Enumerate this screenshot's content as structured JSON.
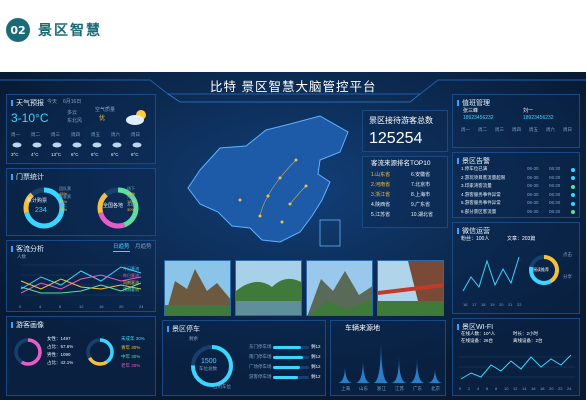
{
  "section": {
    "number": "02",
    "title": "景区智慧"
  },
  "header": {
    "title": "比特 景区智慧大脑管控平台"
  },
  "weather": {
    "title": "天气预报",
    "today_label": "今天",
    "date": "6月16日",
    "temp": "3-10°C",
    "wind_label": "多云",
    "wind_value": "东北风",
    "aqi_label": "空气质量",
    "aqi_value": "优",
    "days": [
      "周一",
      "周二",
      "周三",
      "周四",
      "周五",
      "周六",
      "周日"
    ],
    "temps": [
      "3°C",
      "4°C",
      "13°C",
      "6°C",
      "6°C",
      "6°C",
      "6°C"
    ]
  },
  "tickets": {
    "title": "门票统计",
    "left_label": "累计购票",
    "left_value": "234",
    "right_label": "全国各地",
    "labels": [
      "团队票",
      "散客票",
      "线上",
      "线下",
      "外地",
      "本地"
    ],
    "values": [
      "45%",
      "32%",
      "23%",
      "21%",
      "18%",
      "30%"
    ]
  },
  "visitors_analysis": {
    "title": "客流分析",
    "tab_day": "日趋势",
    "tab_month": "月趋势",
    "y_label": "人数",
    "x_labels": [
      "0",
      "4",
      "8",
      "12",
      "16",
      "20",
      "24"
    ],
    "legend": [
      "今日客流",
      "昨日客流",
      "同期客流",
      "预测客流"
    ]
  },
  "portrait": {
    "title": "游客画像",
    "stats": [
      "女性：1497",
      "占比：57.6%",
      "男性：1090",
      "占比：42.1%"
    ],
    "age_labels": [
      "未成年 30%",
      "青年 30%",
      "中年 30%",
      "老年 30%"
    ]
  },
  "total": {
    "title": "景区接待游客总数",
    "value": "125254"
  },
  "top10": {
    "title": "客流来源排名TOP10",
    "items": [
      "1.山东省",
      "2.河南省",
      "3.浙江省",
      "4.陕西省",
      "5.江苏省",
      "6.安徽省",
      "7.北京市",
      "8.上海市",
      "9.广东省",
      "10.湖北省"
    ]
  },
  "parking": {
    "title": "景区停车",
    "gauge_value": "1500",
    "gauge_label": "车位总数",
    "left_top": "剩余",
    "left_bottom": "占用车位",
    "lots": [
      "东门停车场",
      "南门停车场",
      "广场停车场",
      "游客停车场"
    ],
    "lot_values": [
      "剩12",
      "剩12",
      "剩12",
      "剩12"
    ],
    "lot_fill": [
      0.78,
      0.82,
      0.76,
      0.7
    ]
  },
  "vehicles": {
    "title": "车辆来源地",
    "labels": [
      "上海",
      "山东",
      "浙江",
      "江苏",
      "广东",
      "北京"
    ],
    "values": [
      40,
      55,
      100,
      62,
      58,
      35
    ]
  },
  "info": {
    "title": "值班管理",
    "person1": "张三峰",
    "phone1": "18923456232",
    "person2": "刘一",
    "phone2": "18923456232",
    "days": [
      "周一",
      "周二",
      "周三",
      "周四",
      "周五",
      "周六",
      "周日"
    ]
  },
  "alerts": {
    "title": "景区告警",
    "items": [
      {
        "text": "1.停车位已满",
        "t1": "06-30",
        "t2": "06:30"
      },
      {
        "text": "2.游玩项目客流量超限",
        "t1": "06-30",
        "t2": "06:30"
      },
      {
        "text": "3.印家湾客流量",
        "t1": "06-30",
        "t2": "06:30"
      },
      {
        "text": "4.游客服务事件异常",
        "t1": "06-30",
        "t2": "06:30"
      },
      {
        "text": "5.游客服务事件异常",
        "t1": "06-30",
        "t2": "06:30"
      },
      {
        "text": "6.部分景区客流量",
        "t1": "06-30",
        "t2": "06:30"
      }
    ]
  },
  "wechat": {
    "title": "微信运营",
    "fans": "粉丝：100人",
    "articles": "文章：203篇",
    "ring_label": "阅读推荐",
    "side": [
      "点击",
      "分享"
    ],
    "x_labels": [
      "16",
      "17",
      "18",
      "19",
      "20",
      "21",
      "22"
    ]
  },
  "wifi": {
    "title": "景区WI-FI",
    "online": "在线人数：10^人",
    "time": "时长：2小时",
    "ap_online": "在线设备：26台",
    "ap_offline": "离线设备：2台",
    "x_labels": [
      "0",
      "2",
      "4",
      "6",
      "8",
      "10",
      "12",
      "14",
      "16",
      "18",
      "20",
      "22",
      "24"
    ]
  },
  "colors": {
    "bg": "#081a33",
    "accent": "#3ad6ff",
    "yellow": "#f5c040",
    "pink": "#e85cc8",
    "green": "#5ce0a0"
  }
}
